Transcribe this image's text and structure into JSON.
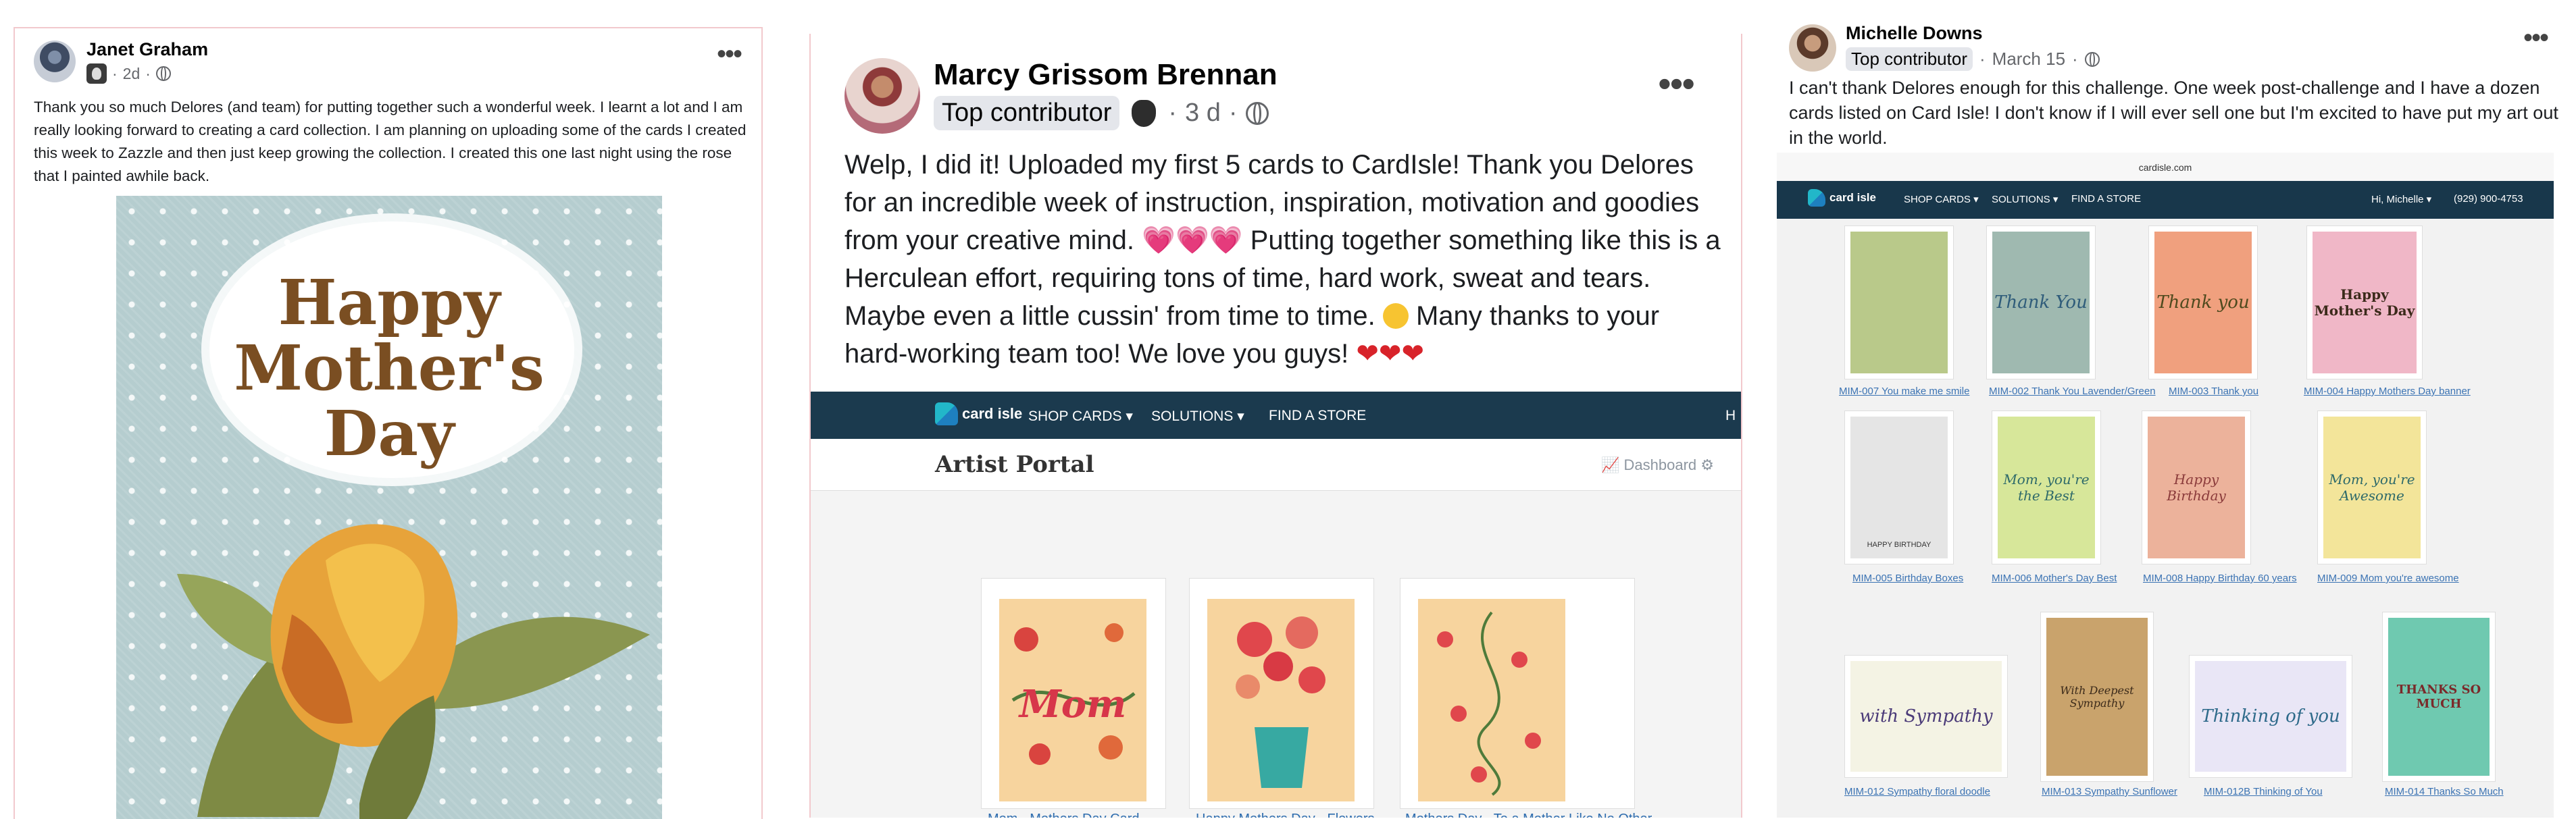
{
  "post1": {
    "author": "Janet Graham",
    "time": "2d",
    "more": "•••",
    "text": "Thank you so much Delores (and team) for putting together such a wonderful week. I learnt a lot and I am really looking forward to creating a card collection.  I am planning on uploading some of the cards I created this week to Zazzle and then just keep growing the collection.  I created this one last night using the rose that I painted awhile back.",
    "card_lines": [
      "Happy",
      "Mother's",
      "Day"
    ]
  },
  "post2": {
    "author": "Marcy Grissom Brennan",
    "badge": "Top contributor",
    "time": "3 d",
    "more": "•••",
    "text_part1": "Welp, I did it! Uploaded my first 5 cards to CardIsle! Thank you Delores for an incredible week of instruction, inspiration, motivation and goodies from your creative mind. ",
    "hearts1": "💗💗💗",
    "text_part2": " Putting together something like this is a Herculean effort, requiring tons of time, hard work, sweat and tears.  Maybe even a little cussin' from time to time. ",
    "text_part3": " Many thanks to your hard-working team too! We love you guys! ",
    "hearts2": "❤❤❤",
    "portal": {
      "logo": "card isle",
      "nav": [
        "SHOP CARDS ▾",
        "SOLUTIONS ▾",
        "FIND A STORE"
      ],
      "nav_cut": "H",
      "title": "Artist Portal",
      "dashboard": "Dashboard",
      "cards": [
        {
          "label": "Mom - Mothers Day Card",
          "art": "Mom"
        },
        {
          "label": "Happy Mothers Day - Flowers",
          "art": ""
        },
        {
          "label": "Mothers Day - To a Mother Like No Other",
          "art": ""
        }
      ]
    }
  },
  "post3": {
    "author": "Michelle Downs",
    "badge": "Top contributor",
    "time": "March 15",
    "more": "•••",
    "text": "I can't thank Delores enough for this challenge. One week post-challenge and I have a dozen cards listed on Card Isle! I don't know if I will ever sell one but I'm excited to have put my art out in the world.",
    "screenshot": {
      "url": "cardisle.com",
      "logo": "card isle",
      "nav": [
        "SHOP CARDS ▾",
        "SOLUTIONS ▾",
        "FIND A STORE"
      ],
      "greeting": "Hi, Michelle ▾",
      "phone": "(929) 900-4753",
      "cards": [
        {
          "label": "MIM-007 You make me smile",
          "bg": "#b9c98a"
        },
        {
          "label": "MIM-002 Thank You Lavender/Green",
          "bg": "#9fb9b0",
          "art": "Thank You"
        },
        {
          "label": "MIM-003 Thank you",
          "bg": "#f0a07e",
          "art": "Thank you"
        },
        {
          "label": "MIM-004 Happy Mothers Day banner",
          "bg": "#f0b7c7",
          "art": "Happy Mother's Day"
        },
        {
          "label": "MIM-005 Birthday Boxes",
          "bg": "#e5e5e5",
          "art": "HAPPY BIRTHDAY"
        },
        {
          "label": "MIM-006 Mother's Day Best",
          "bg": "#d7e79a",
          "art": "Mom, you're the Best"
        },
        {
          "label": "MIM-008 Happy Birthday 60 years",
          "bg": "#ecb29b",
          "art": "Happy Birthday"
        },
        {
          "label": "MIM-009 Mom you're awesome",
          "bg": "#f3e59a",
          "art": "Mom, you're Awesome"
        },
        {
          "label": "MIM-012 Sympathy floral doodle",
          "bg": "#f4f3e4",
          "art": "with Sympathy"
        },
        {
          "label": "MIM-013 Sympathy Sunflower",
          "bg": "#c9a36c",
          "art": "With Deepest Sympathy"
        },
        {
          "label": "MIM-012B Thinking of You",
          "bg": "#e9e6f6",
          "art": "Thinking of you"
        },
        {
          "label": "MIM-014 Thanks So Much",
          "bg": "#6fc9b0",
          "art": "THANKS SO MUCH"
        }
      ]
    }
  },
  "colors": {
    "link": "#2d6cae",
    "nav_bg": "#1b3a4e",
    "card_brown": "#7a4e22"
  }
}
